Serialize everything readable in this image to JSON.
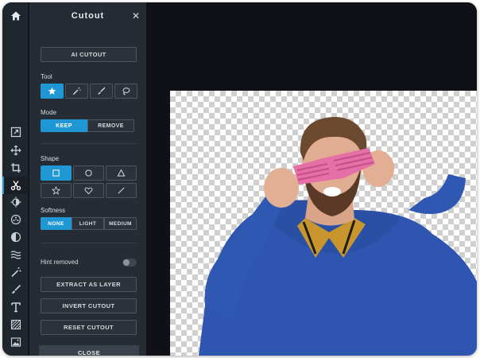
{
  "panel": {
    "title": "Cutout",
    "close_glyph": "✕",
    "ai_cutout_label": "AI CUTOUT",
    "tool_label": "Tool",
    "tools": [
      "star-select-icon",
      "magic-wand-icon",
      "brush-icon",
      "lasso-icon"
    ],
    "mode_label": "Mode",
    "mode_options": [
      "KEEP",
      "REMOVE"
    ],
    "mode_selected": "KEEP",
    "shape_label": "Shape",
    "shapes": [
      "square-icon",
      "circle-icon",
      "triangle-icon",
      "star-icon",
      "heart-icon",
      "line-icon"
    ],
    "shape_selected": "square-icon",
    "softness_label": "Softness",
    "softness_options": [
      "NONE",
      "LIGHT",
      "MEDIUM"
    ],
    "softness_selected": "NONE",
    "hint_label": "Hint removed",
    "hint_on": false,
    "extract_label": "EXTRACT AS LAYER",
    "invert_label": "INVERT CUTOUT",
    "reset_label": "RESET CUTOUT",
    "close_label": "CLOSE"
  },
  "rail": {
    "tools": [
      "home-icon",
      "resize-icon",
      "move-icon",
      "crop-icon",
      "cutout-scissors-icon",
      "adjust-icon",
      "filter-icon",
      "contrast-icon",
      "wave-icon",
      "wand-icon",
      "brush-icon",
      "text-icon",
      "texture-icon",
      "image-icon"
    ],
    "active": "cutout-scissors-icon"
  },
  "colors": {
    "accent": "#1f97d4",
    "panel_bg": "#262c33",
    "rail_bg": "#20262d",
    "canvas_bg": "#0f1116"
  },
  "canvas": {
    "subject": "man in blue sweater wearing pink shutter glasses on transparent background"
  }
}
